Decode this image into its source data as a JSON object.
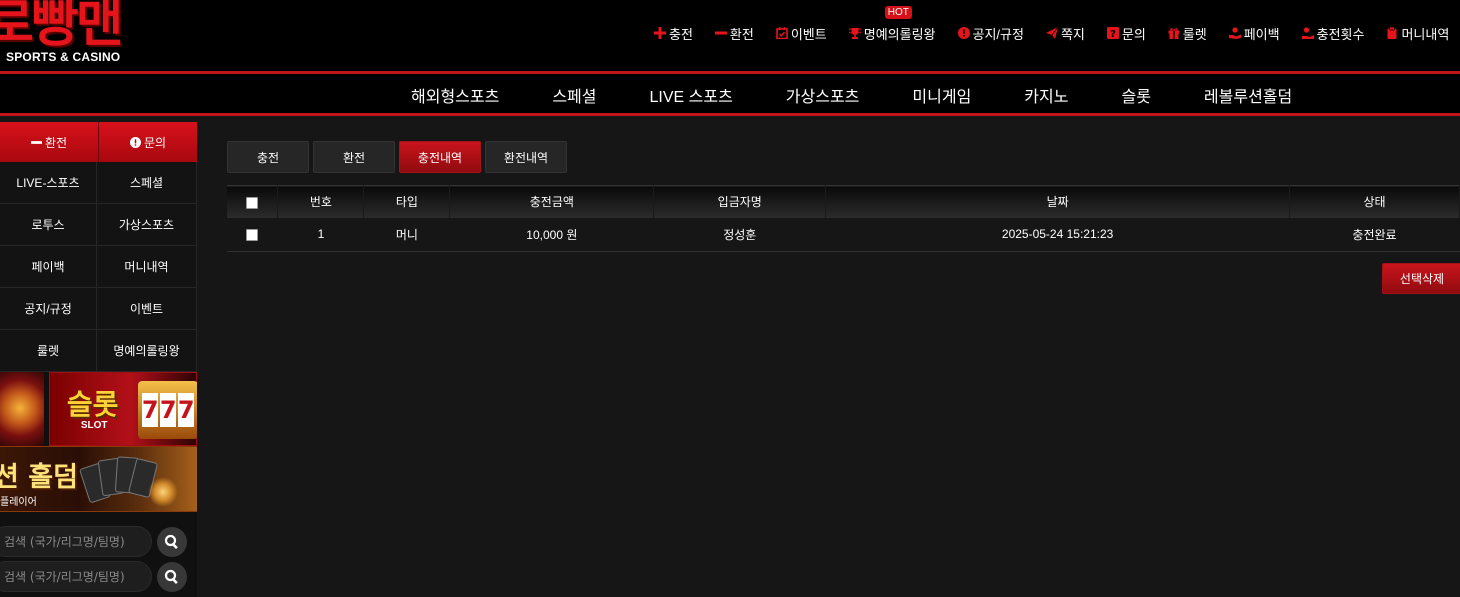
{
  "logo": {
    "text": "로빵맨",
    "subtitle": "SPORTS & CASINO"
  },
  "topmenu": [
    {
      "label": "충전",
      "icon": "plus-icon"
    },
    {
      "label": "환전",
      "icon": "minus-icon"
    },
    {
      "label": "이벤트",
      "icon": "calendar-check-icon"
    },
    {
      "label": "명예의롤링왕",
      "icon": "trophy-icon",
      "badge": "HOT"
    },
    {
      "label": "공지/규정",
      "icon": "exclamation-circle-icon"
    },
    {
      "label": "쪽지",
      "icon": "paper-plane-icon"
    },
    {
      "label": "문의",
      "icon": "question-square-icon"
    },
    {
      "label": "룰렛",
      "icon": "gift-icon"
    },
    {
      "label": "페이백",
      "icon": "hand-coin-icon"
    },
    {
      "label": "충전횟수",
      "icon": "user-hand-icon"
    },
    {
      "label": "머니내역",
      "icon": "clipboard-icon"
    }
  ],
  "mainnav": [
    "해외형스포츠",
    "스페셜",
    "LIVE 스포츠",
    "가상스포츠",
    "미니게임",
    "카지노",
    "슬롯",
    "레볼루션홀덤"
  ],
  "sidebar": {
    "top_buttons": [
      {
        "label": "환전",
        "icon": "minus-icon"
      },
      {
        "label": "문의",
        "icon": "exclamation-circle-icon"
      }
    ],
    "grid": [
      "LIVE-스포츠",
      "스페셜",
      "로투스",
      "가상스포츠",
      "페이백",
      "머니내역",
      "공지/규정",
      "이벤트",
      "룰렛",
      "명예의롤링왕"
    ],
    "banner_slot": {
      "title": "슬롯",
      "sub": "SLOT"
    },
    "banner_holdem": {
      "title": "션 홀덤",
      "sub": "플레이어"
    },
    "search_placeholder": "검색 (국가/리그명/팀명)"
  },
  "content": {
    "tabs": [
      "충전",
      "환전",
      "충전내역",
      "환전내역"
    ],
    "active_tab": 2,
    "columns": [
      "번호",
      "타입",
      "충전금액",
      "입금자명",
      "날짜",
      "상태"
    ],
    "rows": [
      {
        "no": "1",
        "type": "머니",
        "amount": "10,000 원",
        "depositor": "정성훈",
        "date": "2025-05-24 15:21:23",
        "status": "충전완료"
      }
    ],
    "delete_button": "선택삭제"
  },
  "colors": {
    "accent": "#c4141b",
    "background": "#161616",
    "header_bg": "#000000"
  }
}
